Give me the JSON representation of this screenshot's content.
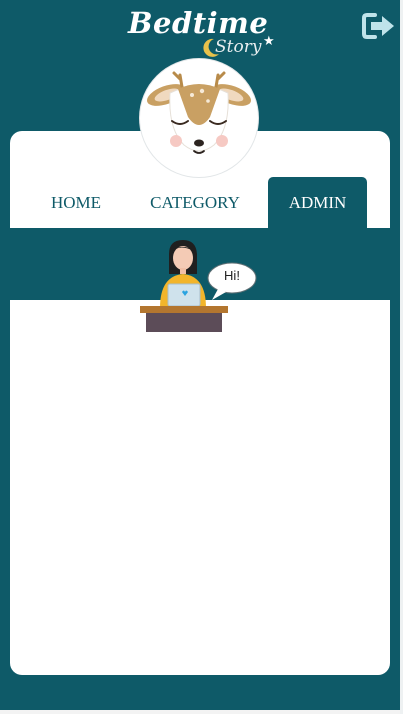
{
  "theme": {
    "primary": "#0e5a68",
    "card": "#ffffff",
    "text_on_primary": "#ffffff"
  },
  "logo": {
    "title": "Bedtime",
    "subtitle": "Story"
  },
  "header": {
    "logout_icon": "logout-icon"
  },
  "nav": {
    "tabs": [
      {
        "label": "HOME",
        "active": false
      },
      {
        "label": "CATEGORY",
        "active": false
      },
      {
        "label": "ADMIN",
        "active": true
      }
    ]
  },
  "illustration": {
    "greeting": "Hi!"
  }
}
